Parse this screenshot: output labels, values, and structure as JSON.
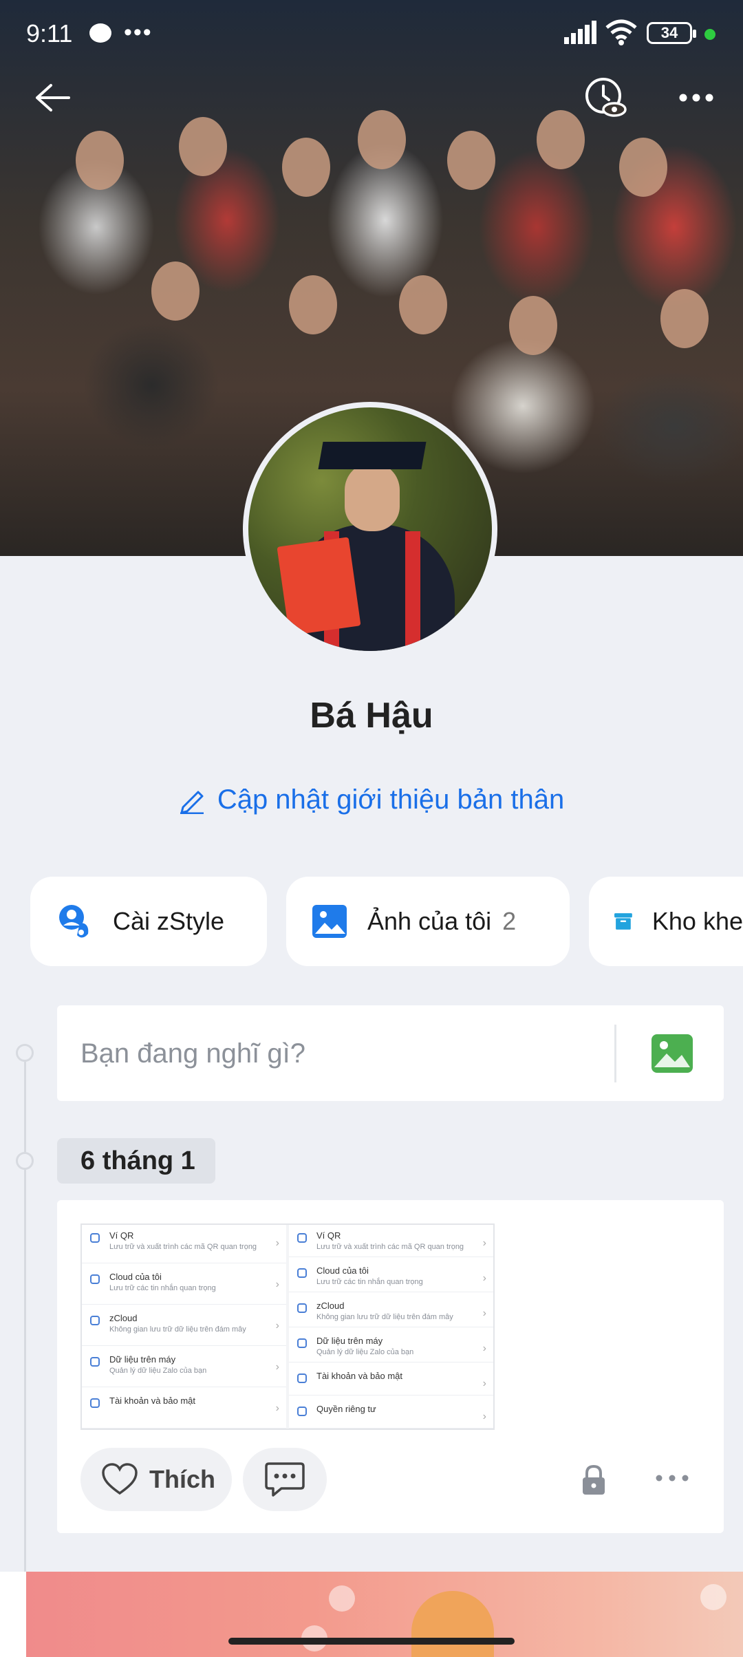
{
  "status_bar": {
    "time": "9:11",
    "notification_dots": "•••",
    "battery": "34"
  },
  "header": {
    "back_icon": "arrow-left-icon",
    "history_icon": "clock-eye-icon",
    "more_icon": "more-horizontal-icon"
  },
  "profile": {
    "name": "Bá Hậu",
    "bio_link": "Cập nhật giới thiệu bản thân"
  },
  "quick_actions": [
    {
      "label": "Cài zStyle",
      "icon": "zstyle-icon"
    },
    {
      "label": "Ảnh của tôi",
      "count": "2",
      "icon": "photo-icon"
    },
    {
      "label": "Kho khe",
      "icon": "archive-box-icon"
    }
  ],
  "composer": {
    "placeholder": "Bạn đang nghĩ gì?"
  },
  "timeline": {
    "date_label": "6 tháng 1"
  },
  "post": {
    "screenshot_rows_left": [
      {
        "title": "Ví QR",
        "sub": "Lưu trữ và xuất trình các mã QR quan trọng"
      },
      {
        "title": "Cloud của tôi",
        "sub": "Lưu trữ các tin nhắn quan trọng"
      },
      {
        "title": "zCloud",
        "sub": "Không gian lưu trữ dữ liệu trên đám mây"
      },
      {
        "title": "Dữ liệu trên máy",
        "sub": "Quản lý dữ liệu Zalo của bạn"
      },
      {
        "title": "Tài khoản và bảo mật",
        "sub": ""
      }
    ],
    "screenshot_rows_right": [
      {
        "title": "Ví QR",
        "sub": "Lưu trữ và xuất trình các mã QR quan trọng"
      },
      {
        "title": "Cloud của tôi",
        "sub": "Lưu trữ các tin nhắn quan trọng"
      },
      {
        "title": "zCloud",
        "sub": "Không gian lưu trữ dữ liệu trên đám mây"
      },
      {
        "title": "Dữ liệu trên máy",
        "sub": "Quản lý dữ liệu Zalo của bạn"
      },
      {
        "title": "Tài khoản và bảo mật",
        "sub": ""
      },
      {
        "title": "Quyền riêng tư",
        "sub": ""
      }
    ],
    "like_label": "Thích"
  },
  "colors": {
    "accent": "#1a6fe8",
    "background": "#eef0f5"
  }
}
